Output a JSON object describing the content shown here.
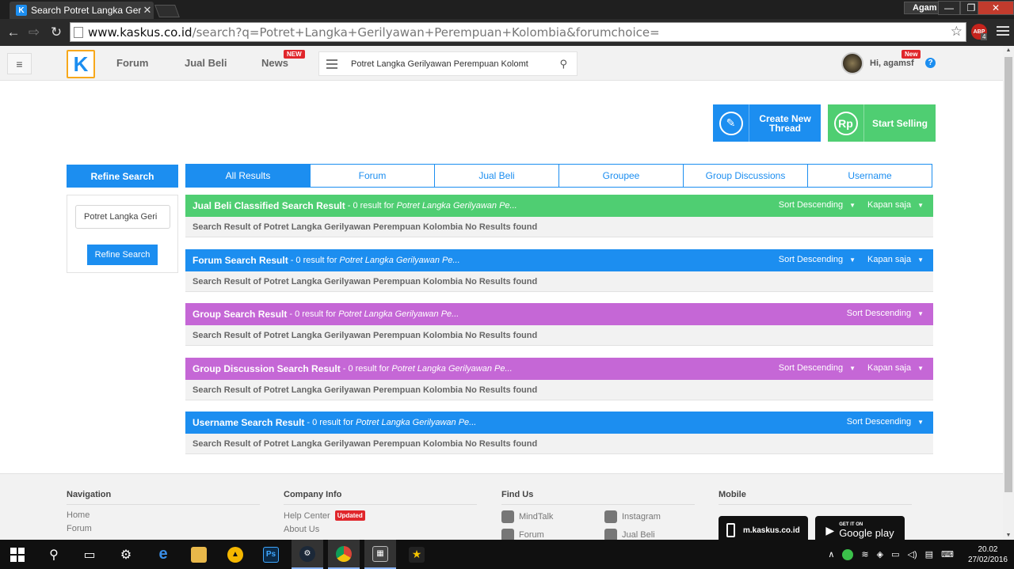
{
  "browser": {
    "tab_title": "Search Potret Langka Geril",
    "tab_close": "✕",
    "user_name": "Agam",
    "url_domain": "www.kaskus.co.id",
    "url_path": "/search?q=Potret+Langka+Gerilyawan+Perempuan+Kolombia&forumchoice=",
    "abp_label": "ABP",
    "abp_count": "4"
  },
  "header": {
    "logo_text": "K",
    "nav": [
      {
        "label": "Forum"
      },
      {
        "label": "Jual Beli"
      },
      {
        "label": "News",
        "badge": "NEW"
      }
    ],
    "search_value": "Potret Langka Gerilyawan Perempuan Kolomt",
    "greeting": "Hi, agamsf",
    "user_badge": "New",
    "help": "?"
  },
  "actions": {
    "create_thread": "Create New Thread",
    "start_selling": "Start Selling",
    "sell_icon": "Rp"
  },
  "refine": {
    "title": "Refine Search",
    "input_value": "Potret Langka Geri",
    "button": "Refine Search"
  },
  "tabs": [
    "All Results",
    "Forum",
    "Jual Beli",
    "Groupee",
    "Group Discussions",
    "Username"
  ],
  "results": [
    {
      "title": "Jual Beli Classified Search Result",
      "meta": "- 0 result for",
      "query": "Potret Langka Gerilyawan Pe...",
      "sort": "Sort Descending",
      "time": "Kapan saja",
      "color": "#4fce72",
      "body": "Search Result of Potret Langka Gerilyawan Perempuan Kolombia No Results found"
    },
    {
      "title": "Forum Search Result",
      "meta": "- 0 result for",
      "query": "Potret Langka Gerilyawan Pe...",
      "sort": "Sort Descending",
      "time": "Kapan saja",
      "color": "#1c8ef0",
      "body": "Search Result of Potret Langka Gerilyawan Perempuan Kolombia No Results found"
    },
    {
      "title": "Group Search Result",
      "meta": "- 0 result for",
      "query": "Potret Langka Gerilyawan Pe...",
      "sort": "Sort Descending",
      "color": "#c567d6",
      "body": "Search Result of Potret Langka Gerilyawan Perempuan Kolombia No Results found"
    },
    {
      "title": "Group Discussion Search Result",
      "meta": "- 0 result for",
      "query": "Potret Langka Gerilyawan Pe...",
      "sort": "Sort Descending",
      "time": "Kapan saja",
      "color": "#c567d6",
      "body": "Search Result of Potret Langka Gerilyawan Perempuan Kolombia No Results found"
    },
    {
      "title": "Username Search Result",
      "meta": "- 0 result for",
      "query": "Potret Langka Gerilyawan Pe...",
      "sort": "Sort Descending",
      "color": "#1c8ef0",
      "body": "Search Result of Potret Langka Gerilyawan Perempuan Kolombia No Results found"
    }
  ],
  "footer": {
    "navigation": {
      "title": "Navigation",
      "links": [
        "Home",
        "Forum"
      ]
    },
    "company": {
      "title": "Company Info",
      "links": [
        "Help Center",
        "About Us"
      ],
      "updated_badge": "Updated"
    },
    "find_us": {
      "title": "Find Us",
      "links": [
        "MindTalk",
        "Instagram",
        "Forum",
        "Jual Beli"
      ]
    },
    "mobile": {
      "title": "Mobile",
      "site": "m.kaskus.co.id",
      "gp_small": "GET IT ON",
      "gp_big": "Google play"
    }
  },
  "taskbar": {
    "time": "20.02",
    "date": "27/02/2016",
    "ps_label": "Ps"
  },
  "colors": {
    "brand_blue": "#1c8ef0",
    "green": "#4fce72",
    "purple": "#c567d6",
    "logo_orange": "#f7a81b",
    "badge_red": "#e0262b"
  }
}
